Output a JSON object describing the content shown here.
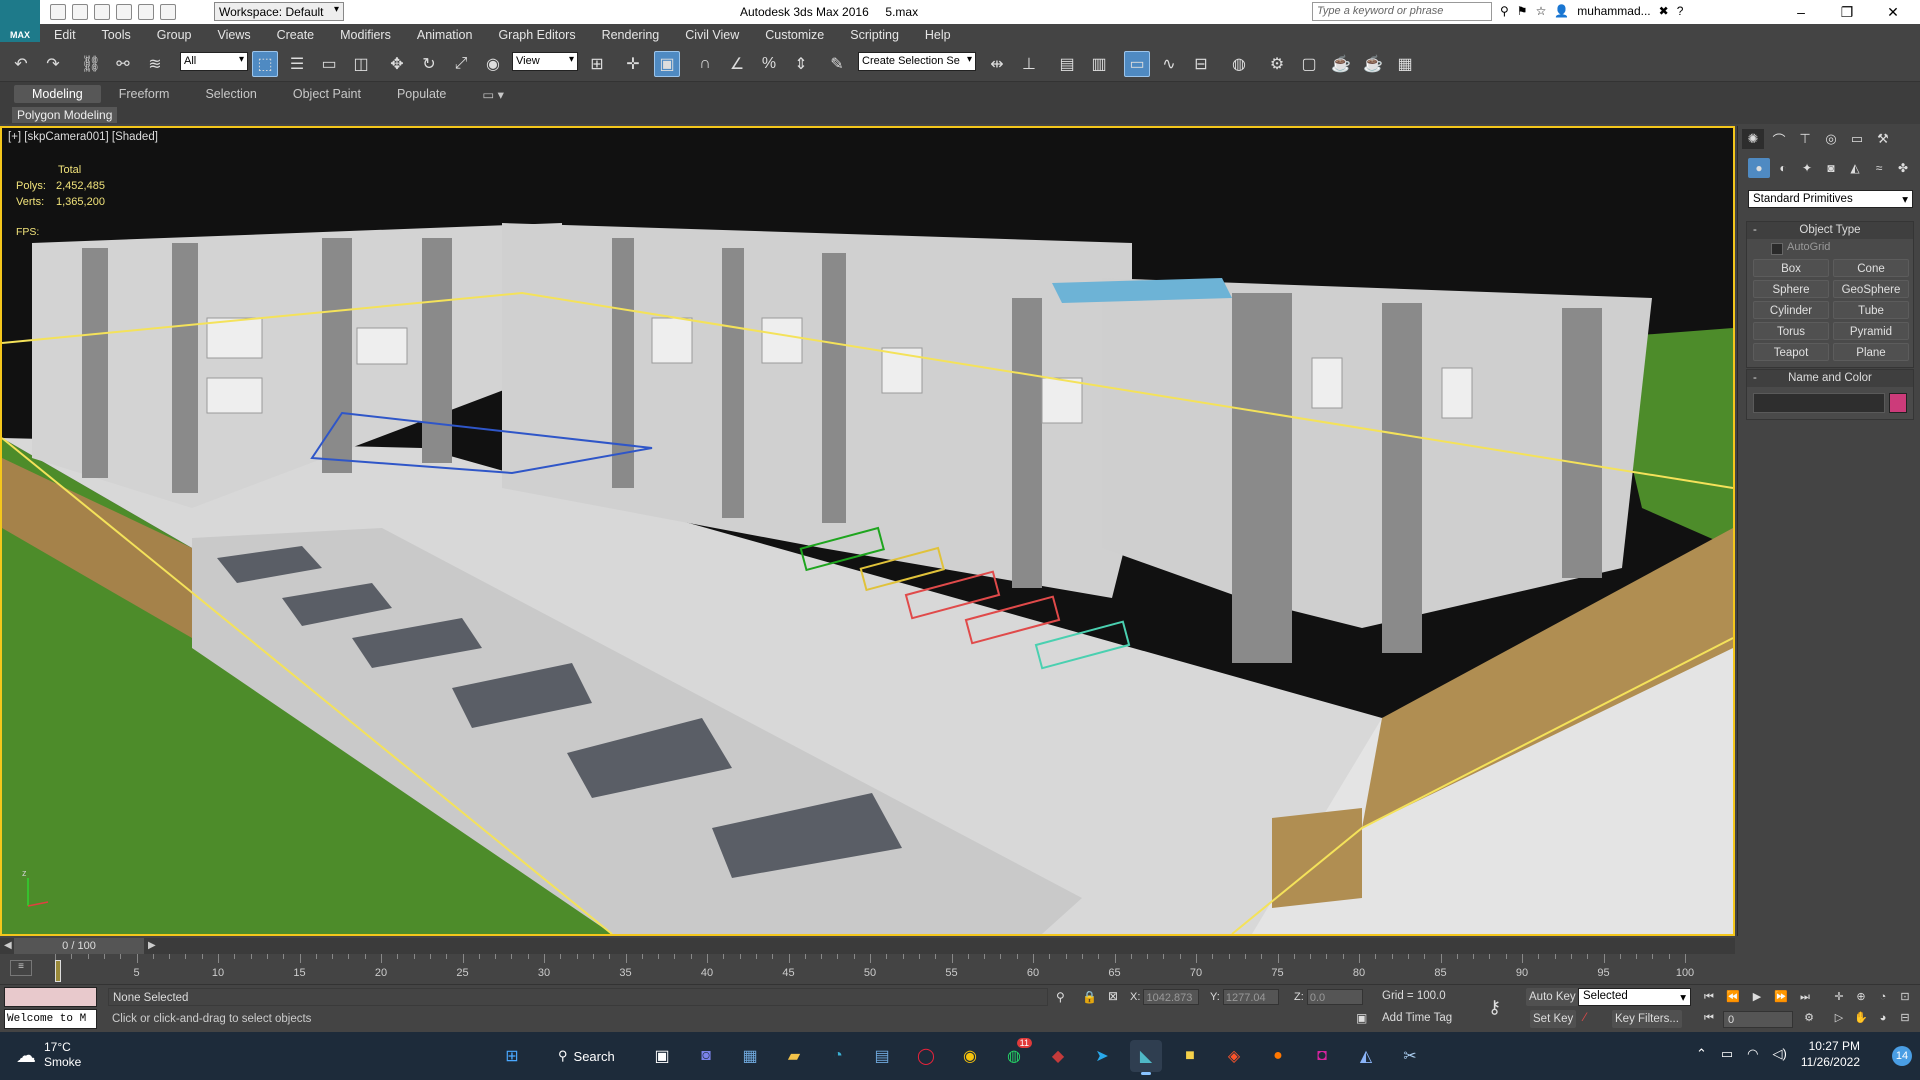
{
  "titlebar": {
    "logo": "MAX",
    "workspace": "Workspace: Default",
    "app_title": "Autodesk 3ds Max 2016",
    "file_name": "5.max",
    "search_placeholder": "Type a keyword or phrase",
    "user": "muhammad...",
    "minimize": "–",
    "maximize": "❐",
    "close": "✕"
  },
  "menu": [
    "Edit",
    "Tools",
    "Group",
    "Views",
    "Create",
    "Modifiers",
    "Animation",
    "Graph Editors",
    "Rendering",
    "Civil View",
    "Customize",
    "Scripting",
    "Help"
  ],
  "toolbar": {
    "selection_filter": "All",
    "ref_coord": "View",
    "named_selection": "Create Selection Se"
  },
  "ribbon": {
    "tabs": [
      "Modeling",
      "Freeform",
      "Selection",
      "Object Paint",
      "Populate"
    ],
    "active_tab": "Modeling",
    "sub": "Polygon Modeling"
  },
  "viewport": {
    "label": "[+] [skpCamera001] [Shaded]",
    "stats_header": "Total",
    "polys_label": "Polys:",
    "polys_value": "2,452,485",
    "verts_label": "Verts:",
    "verts_value": "1,365,200",
    "fps_label": "FPS:"
  },
  "command_panel": {
    "category": "Standard Primitives",
    "object_type_title": "Object Type",
    "autogrid": "AutoGrid",
    "primitives": [
      "Box",
      "Cone",
      "Sphere",
      "GeoSphere",
      "Cylinder",
      "Tube",
      "Torus",
      "Pyramid",
      "Teapot",
      "Plane"
    ],
    "name_color_title": "Name and Color",
    "color": "#cc3b7a"
  },
  "timeline": {
    "frame_display": "0 / 100",
    "ticks": [
      0,
      5,
      10,
      15,
      20,
      25,
      30,
      35,
      40,
      45,
      50,
      55,
      60,
      65,
      70,
      75,
      80,
      85,
      90,
      95,
      100
    ],
    "labels": [
      5,
      10,
      15,
      20,
      25,
      30,
      35,
      40,
      45,
      50,
      55,
      60,
      65,
      70,
      75,
      80,
      85,
      90,
      95,
      100
    ]
  },
  "status": {
    "maxscript": "Welcome to M",
    "selection": "None Selected",
    "prompt": "Click or click-and-drag to select objects",
    "x_label": "X:",
    "x_value": "1042.873",
    "y_label": "Y:",
    "y_value": "1277.04",
    "z_label": "Z:",
    "z_value": "0.0",
    "grid": "Grid = 100.0",
    "add_time_tag": "Add Time Tag",
    "auto_key": "Auto Key",
    "set_key": "Set Key",
    "key_mode": "Selected",
    "key_filters": "Key Filters...",
    "current_frame": "0"
  },
  "taskbar": {
    "temp": "17°C",
    "weather": "Smoke",
    "search": "Search",
    "whatsapp_badge": "11",
    "time": "10:27 PM",
    "date": "11/26/2022",
    "notifications": "14"
  }
}
